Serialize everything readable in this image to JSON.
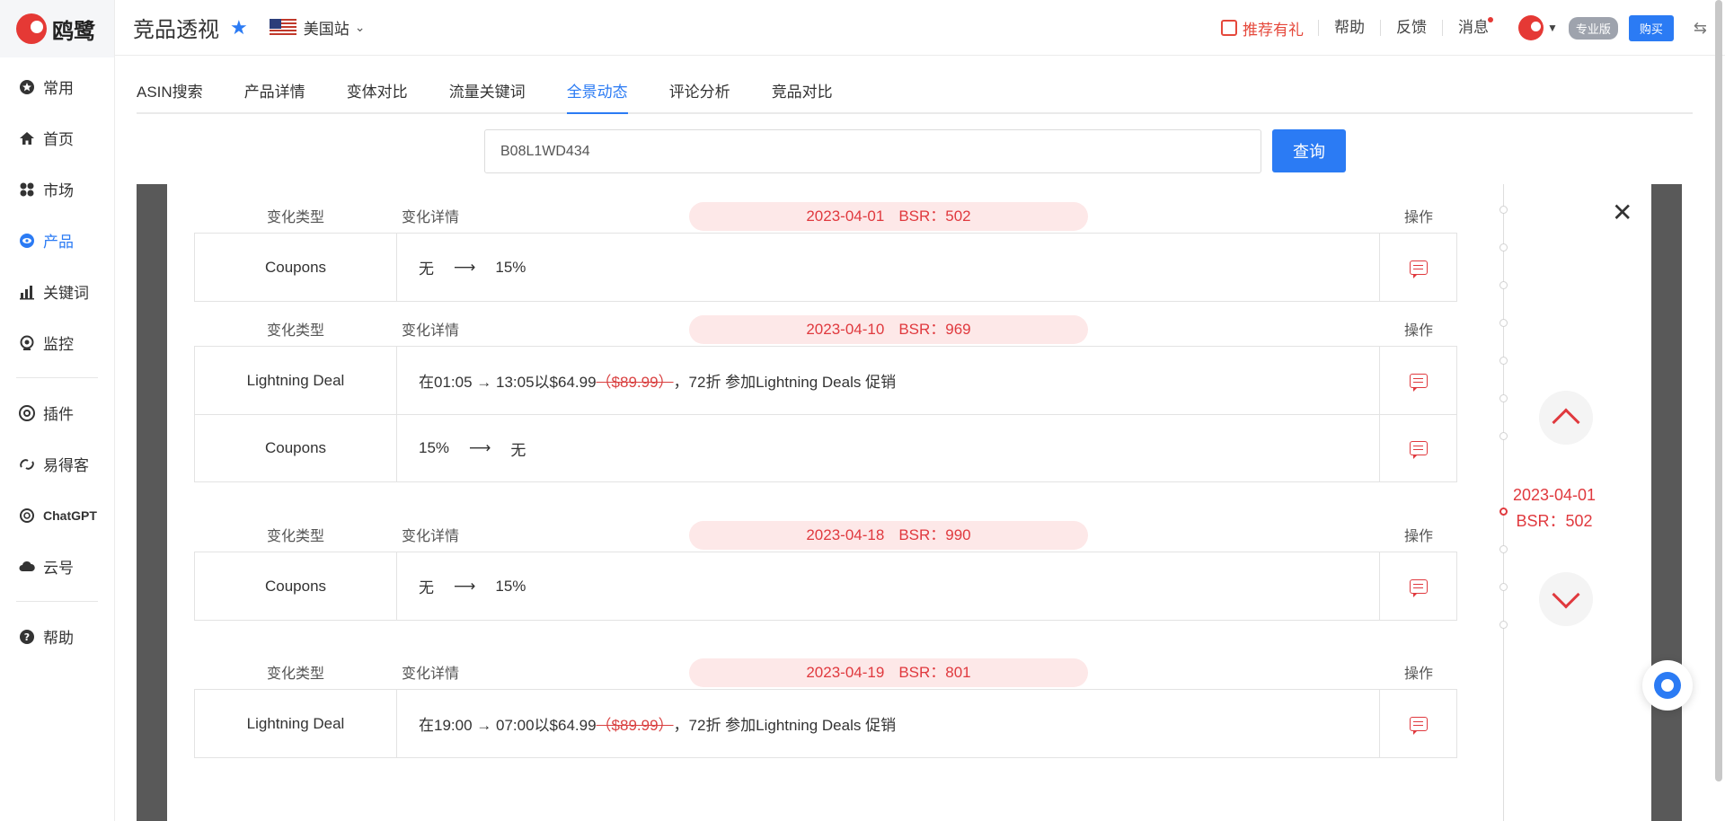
{
  "app": {
    "logo_text": "鸥鹭"
  },
  "sidebar": {
    "items": [
      {
        "label": "常用",
        "icon": "star-circle-icon"
      },
      {
        "label": "首页",
        "icon": "home-icon"
      },
      {
        "label": "市场",
        "icon": "grid-icon"
      },
      {
        "label": "产品",
        "icon": "eye-icon",
        "active": true
      },
      {
        "label": "关键词",
        "icon": "bar-chart-icon"
      },
      {
        "label": "监控",
        "icon": "camera-icon"
      },
      {
        "label": "插件",
        "icon": "chrome-icon"
      },
      {
        "label": "易得客",
        "icon": "link-icon"
      },
      {
        "label": "ChatGPT",
        "icon": "openai-icon"
      },
      {
        "label": "云号",
        "icon": "cloud-icon"
      },
      {
        "label": "帮助",
        "icon": "help-icon"
      }
    ]
  },
  "header": {
    "title": "竞品透视",
    "site": "美国站",
    "promo": "推荐有礼",
    "help": "帮助",
    "feedback": "反馈",
    "messages": "消息",
    "edition": "专业版",
    "buy": "购买"
  },
  "tabs": [
    {
      "label": "ASIN搜索"
    },
    {
      "label": "产品详情"
    },
    {
      "label": "变体对比"
    },
    {
      "label": "流量关键词"
    },
    {
      "label": "全景动态",
      "active": true
    },
    {
      "label": "评论分析"
    },
    {
      "label": "竞品对比"
    }
  ],
  "search": {
    "value": "B08L1WD434",
    "button": "查询"
  },
  "table_headers": {
    "type": "变化类型",
    "detail": "变化详情",
    "op": "操作"
  },
  "groups": [
    {
      "date": "2023-04-01",
      "bsr": "BSR：502",
      "rows": [
        {
          "type": "Coupons",
          "from": "无",
          "to": "15%"
        }
      ]
    },
    {
      "date": "2023-04-10",
      "bsr": "BSR：969",
      "rows": [
        {
          "type": "Lightning Deal",
          "pre": "在01:05 → 13:05以$64.99",
          "strike": "（$89.99）",
          "post": "，72折 参加Lightning Deals 促销"
        },
        {
          "type": "Coupons",
          "from": "15%",
          "to": "无"
        }
      ]
    },
    {
      "date": "2023-04-18",
      "bsr": "BSR：990",
      "rows": [
        {
          "type": "Coupons",
          "from": "无",
          "to": "15%"
        }
      ]
    },
    {
      "date": "2023-04-19",
      "bsr": "BSR：801",
      "rows": [
        {
          "type": "Lightning Deal",
          "pre": "在19:00 → 07:00以$64.99",
          "strike": "（$89.99）",
          "post": "，72折 参加Lightning Deals 促销"
        }
      ]
    }
  ],
  "timeline": {
    "date": "2023-04-01",
    "bsr": "BSR：502"
  },
  "colors": {
    "accent": "#2b7bf4",
    "danger": "#e0393e",
    "date_bg": "#fde8e8"
  }
}
